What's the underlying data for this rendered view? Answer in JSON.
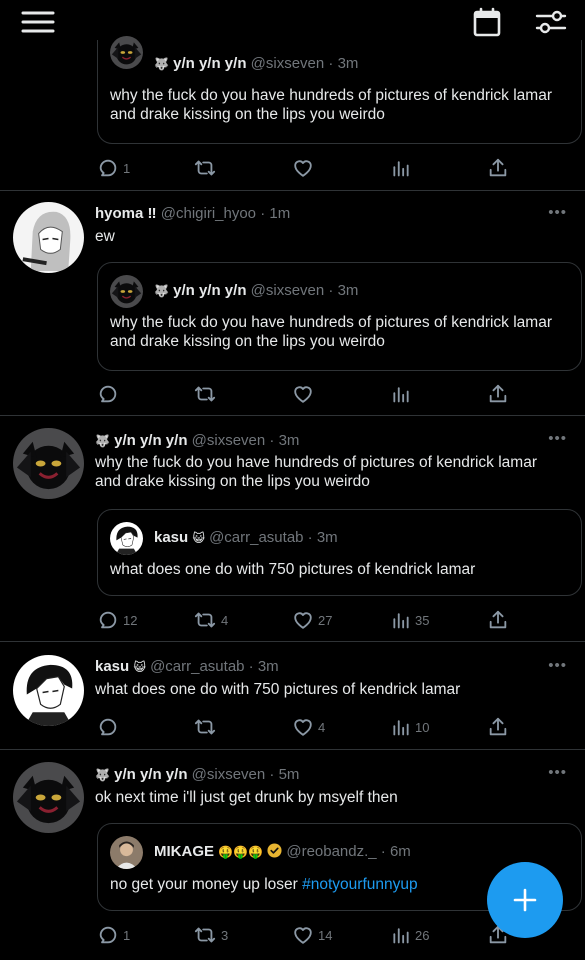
{
  "icons": {
    "menu": "hamburger-menu-icon",
    "calendar": "calendar-icon",
    "filters": "sliders-icon",
    "reply": "reply-icon",
    "retweet": "retweet-icon",
    "like": "heart-icon",
    "views": "views-chart-icon",
    "share": "share-icon",
    "compose": "plus-icon"
  },
  "colors": {
    "accent": "#1d9bf0",
    "background": "#000000",
    "muted": "#71767b",
    "divider": "#2f3336"
  },
  "tweets": [
    {
      "quote": {
        "emoji": "🐺",
        "name": "y/n y/n y/n",
        "handle_time": "@sixseven · 3m",
        "text": "why the fuck do you have hundreds of pictures of kendrick lamar and drake kissing on the lips you weirdo"
      },
      "actions": {
        "replies": "1",
        "retweets": "",
        "likes": "",
        "views": ""
      }
    },
    {
      "name": "hyoma ‼",
      "handle_time": "@chigiri_hyoo · 1m",
      "text": "ew",
      "more": "•••",
      "quote": {
        "emoji": "🐺",
        "name": "y/n y/n y/n",
        "handle_time": "@sixseven · 3m",
        "text": "why the fuck do you have hundreds of pictures of kendrick lamar and drake kissing on the lips you weirdo"
      },
      "actions": {
        "replies": "",
        "retweets": "",
        "likes": "",
        "views": ""
      }
    },
    {
      "emoji": "🐺",
      "name": "y/n y/n y/n",
      "handle_time": "@sixseven · 3m",
      "text": "why the fuck do you have hundreds of pictures of kendrick lamar and drake kissing on the lips you weirdo",
      "more": "•••",
      "quote": {
        "name": "kasu",
        "emoji": "😺",
        "handle_time": "@carr_asutab · 3m",
        "text": "what does one do with 750 pictures of kendrick lamar"
      },
      "actions": {
        "replies": "12",
        "retweets": "4",
        "likes": "27",
        "views": "35"
      }
    },
    {
      "name": "kasu",
      "emoji": "😺",
      "handle_time": "@carr_asutab · 3m",
      "text": "what does one do with 750 pictures of kendrick lamar",
      "more": "•••",
      "actions": {
        "replies": "",
        "retweets": "",
        "likes": "4",
        "views": "10"
      }
    },
    {
      "emoji": "🐺",
      "name": "y/n y/n y/n",
      "handle_time": "@sixseven · 5m",
      "text": "ok next time i'll just get drunk by msyelf then",
      "more": "•••",
      "quote": {
        "name": "MIKAGE",
        "emoji": "🤑🤑🤑",
        "handle_time": "@reobandz._ · 6m",
        "text": "no get your money up loser ",
        "hashtag": "#notyourfunnyup"
      },
      "actions": {
        "replies": "1",
        "retweets": "3",
        "likes": "14",
        "views": "26"
      }
    }
  ]
}
